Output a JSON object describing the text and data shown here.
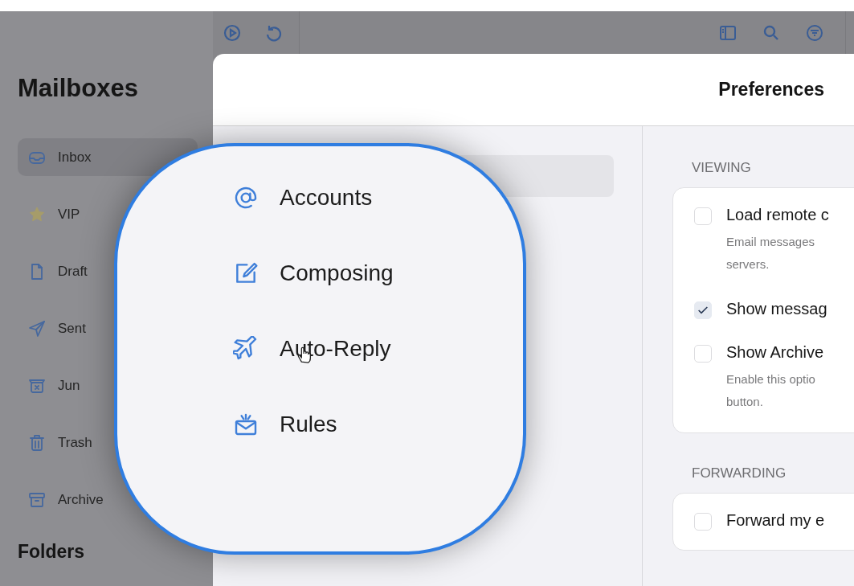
{
  "sidebar": {
    "title": "Mailboxes",
    "items": [
      {
        "label": "Inbox",
        "selected": true
      },
      {
        "label": "VIP",
        "selected": false
      },
      {
        "label": "Draft",
        "selected": false
      },
      {
        "label": "Sent",
        "selected": false
      },
      {
        "label": "Jun",
        "selected": false
      },
      {
        "label": "Trash",
        "selected": false
      },
      {
        "label": "Archive",
        "selected": false
      }
    ],
    "section_title": "Folders"
  },
  "preferences": {
    "title": "Preferences",
    "nav": [
      {
        "label": "Accounts",
        "selected": true
      },
      {
        "label": "Composing",
        "selected": false
      },
      {
        "label": "Auto-Reply",
        "selected": false
      },
      {
        "label": "Rules",
        "selected": false
      }
    ],
    "sections": [
      {
        "heading": "VIEWING",
        "options": [
          {
            "label": "Load remote c",
            "checked": false,
            "description_lines": [
              "Email messages",
              "servers."
            ]
          },
          {
            "label": "Show messag",
            "checked": true
          },
          {
            "label": "Show Archive",
            "checked": false,
            "description_lines": [
              "Enable this optio",
              "button."
            ]
          }
        ]
      },
      {
        "heading": "FORWARDING",
        "options": [
          {
            "label": "Forward my e",
            "checked": false
          }
        ]
      }
    ]
  }
}
